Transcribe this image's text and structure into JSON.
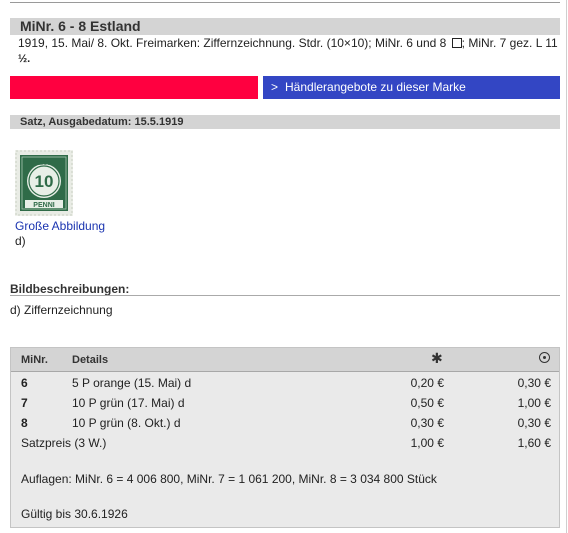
{
  "header": {
    "title": "MiNr. 6 - 8 Estland",
    "description_main": "1919, 15. Mai/ 8. Okt. Freimarken: Ziffernzeichnung. Stdr. (10×10); MiNr. 6 und 8",
    "description_tail": "; MiNr. 7 gez. L 11",
    "description_frac": "½."
  },
  "actions": {
    "dealer_arrow": ">",
    "dealer_label": "Händlerangebote zu dieser Marke"
  },
  "set_section": {
    "label": "Satz, Ausgabedatum: 15.5.1919"
  },
  "stamp": {
    "image_value": "10",
    "image_text_top": "EESTI",
    "image_text_bottom": "PENNI",
    "large_image_link": "Große Abbildung",
    "caption": "d)"
  },
  "image_descriptions": {
    "heading": "Bildbeschreibungen:",
    "items": [
      "d) Ziffernzeichnung"
    ]
  },
  "price_table": {
    "headers": {
      "nr": "MiNr.",
      "details": "Details",
      "mint_icon": "✱",
      "used_icon": "circle-dot-icon"
    },
    "rows": [
      {
        "nr": "6",
        "details": "5 P orange (15. Mai) d",
        "mint": "0,20 €",
        "used": "0,30 €"
      },
      {
        "nr": "7",
        "details": "10 P grün (17. Mai) d",
        "mint": "0,50 €",
        "used": "1,00 €"
      },
      {
        "nr": "8",
        "details": "10 P grün (8. Okt.) d",
        "mint": "0,30 €",
        "used": "0,30 €"
      }
    ],
    "set_price": {
      "label": "Satzpreis (3 W.)",
      "mint": "1,00 €",
      "used": "1,60 €"
    },
    "auflagen": "Auflagen: MiNr. 6 = 4 006 800, MiNr. 7 = 1 061 200, MiNr. 8 = 3 034 800 Stück",
    "gueltig": "Gültig bis 30.6.1926"
  },
  "colors": {
    "red_bar": "#ff0040",
    "dealer_button": "#3346c4",
    "header_gray": "#d4d4d4",
    "link_blue": "#1a34b0",
    "stamp_green": "#2f6b48"
  }
}
